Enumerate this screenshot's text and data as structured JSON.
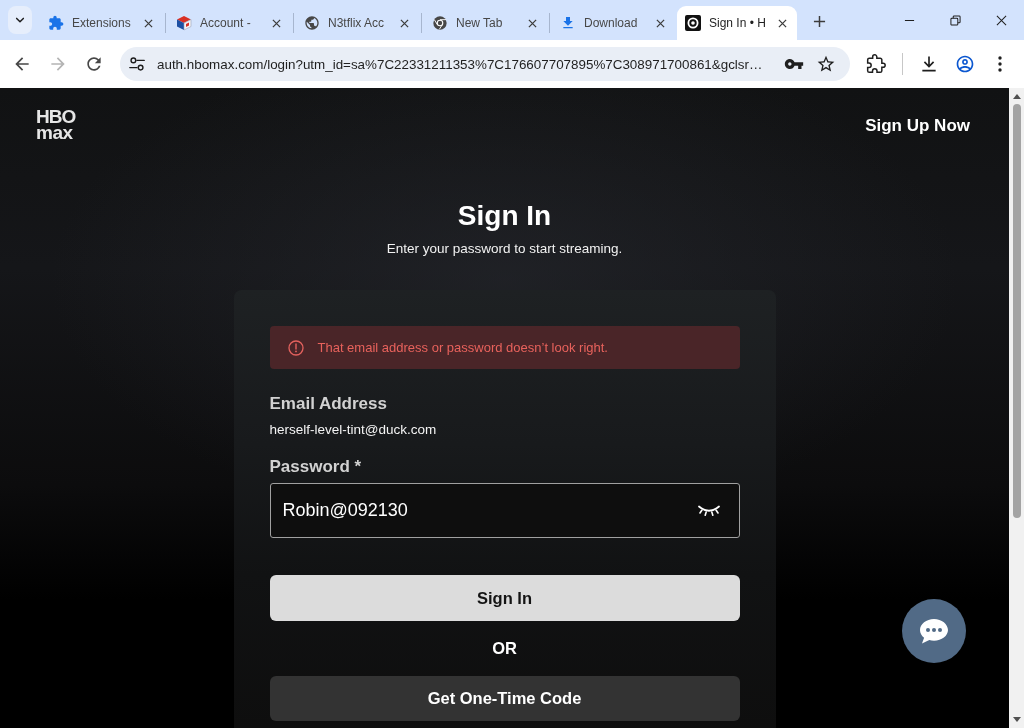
{
  "browser": {
    "tabs": [
      {
        "title": "Extensions",
        "selected": false
      },
      {
        "title": "Account -",
        "selected": false
      },
      {
        "title": "N3tflix Acc",
        "selected": false
      },
      {
        "title": "New Tab",
        "selected": false
      },
      {
        "title": "Download",
        "selected": false
      },
      {
        "title": "Sign In • H",
        "selected": true
      }
    ],
    "nav_buttons": [
      {
        "kind": "back",
        "disabled": false
      },
      {
        "kind": "forward",
        "disabled": true
      },
      {
        "kind": "reload",
        "disabled": false
      }
    ],
    "url": "auth.hbomax.com/login?utm_id=sa%7C22331211353%7C176607707895%7C308971700861&gclsr…"
  },
  "page": {
    "logo": {
      "top": "HBO",
      "bottom": "max"
    },
    "sign_up_link": "Sign Up Now",
    "title": "Sign In",
    "subtitle": "Enter your password to start streaming.",
    "form": {
      "error": "That email address or password doesn’t look right.",
      "email_label": "Email Address",
      "email_value": "herself-level-tint@duck.com",
      "password_label": "Password *",
      "password_value": "Robin@092130",
      "password_visible": true,
      "primary_button": "Sign In",
      "divider": "OR",
      "secondary_button": "Get One-Time Code"
    }
  }
}
